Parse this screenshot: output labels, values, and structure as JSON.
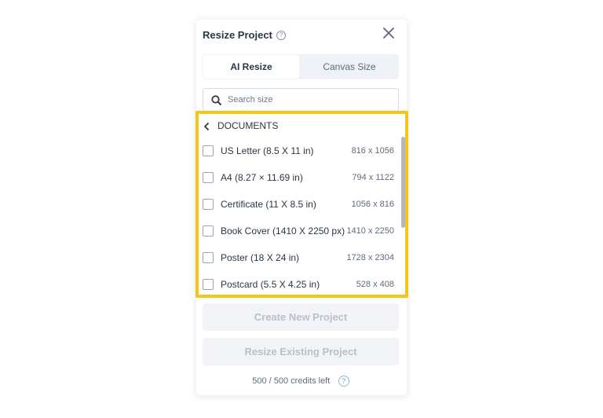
{
  "header": {
    "title": "Resize Project",
    "help_glyph": "?",
    "close_icon": "close-icon"
  },
  "tabs": [
    {
      "label": "AI Resize",
      "active": true
    },
    {
      "label": "Canvas Size",
      "active": false
    }
  ],
  "search": {
    "placeholder": "Search size",
    "value": ""
  },
  "category": {
    "label": "DOCUMENTS",
    "icon": "chevron-left-icon"
  },
  "sizes": [
    {
      "name": "US Letter (8.5 X 11 in)",
      "dims": "816 x 1056",
      "checked": false
    },
    {
      "name": "A4 (8.27 × 11.69 in)",
      "dims": "794 x 1122",
      "checked": false
    },
    {
      "name": "Certificate (11 X 8.5 in)",
      "dims": "1056 x 816",
      "checked": false
    },
    {
      "name": "Book Cover (1410 X 2250 px)",
      "dims": "1410 x 2250",
      "checked": false
    },
    {
      "name": "Poster (18 X 24 in)",
      "dims": "1728 x 2304",
      "checked": false
    },
    {
      "name": "Postcard (5.5 X 4.25 in)",
      "dims": "528 x 408",
      "checked": false
    }
  ],
  "actions": {
    "create_label": "Create New Project",
    "resize_label": "Resize Existing Project"
  },
  "credits": {
    "text": "500 / 500 credits left",
    "help_glyph": "?"
  },
  "colors": {
    "highlight": "#f5c518",
    "disabled_text": "#b8c0cb",
    "tab_bg": "#eef1f5"
  }
}
